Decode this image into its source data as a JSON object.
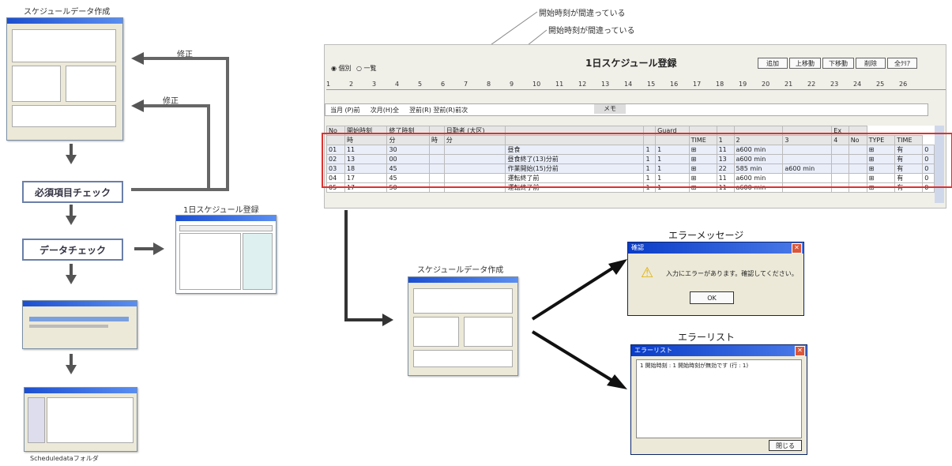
{
  "left_flow": {
    "top_caption": "スケジュールデータ作成",
    "fix_label_1": "修正",
    "fix_label_2": "修正",
    "box_required": "必須項目チェック",
    "box_data": "データチェック",
    "side_caption": "1日スケジュール登録",
    "bottom_caption": "Scheduledataフォルダ"
  },
  "annotations": {
    "note_1": "開始時刻が間違っている",
    "note_2": "開始時刻が間違っている"
  },
  "schedule_window": {
    "title": "1日スケジュール登録",
    "radio_1": "個別",
    "radio_2": "一覧",
    "buttons": [
      "追加",
      "上移動",
      "下移動",
      "削除",
      "全ｸﾘｱ"
    ],
    "day_tabs": [
      "1",
      "2",
      "3",
      "4",
      "5",
      "6",
      "7",
      "8",
      "9",
      "10",
      "11",
      "12",
      "13",
      "14",
      "15",
      "16",
      "17",
      "18",
      "19",
      "20",
      "21",
      "22",
      "23",
      "24",
      "25",
      "26"
    ],
    "filter_left": "当月 (P)前 　 次月(H)全 　 翌前(R) 翌前(R)前次",
    "filter_right": "メモ",
    "header_1": [
      "No",
      "開始時刻",
      "終了時刻",
      "",
      "日勤者 (大区)",
      "",
      "",
      "Guard",
      "",
      "",
      "",
      "",
      "Ex",
      ""
    ],
    "header_2": [
      "",
      "時",
      "分",
      "時",
      "分",
      "",
      "",
      "",
      "TIME",
      "1",
      "2",
      "3",
      "4",
      "No",
      "TYPE",
      "TIME"
    ],
    "rows": [
      [
        "01",
        "11",
        "30",
        "",
        "",
        "昼食",
        "1",
        "1",
        "⊞",
        "11",
        "a600 min",
        "",
        "",
        "",
        "⊞",
        "有",
        "0"
      ],
      [
        "02",
        "13",
        "00",
        "",
        "",
        "昼食終了(13)分前",
        "1",
        "1",
        "⊞",
        "13",
        "a600 min",
        "",
        "",
        "",
        "⊞",
        "有",
        "0"
      ],
      [
        "03",
        "18",
        "45",
        "",
        "",
        "作業開始(15)分前",
        "1",
        "1",
        "⊞",
        "22",
        "585 min",
        "a600 min",
        "",
        "",
        "⊞",
        "有",
        "0"
      ],
      [
        "04",
        "17",
        "45",
        "",
        "",
        "運転終了前",
        "1",
        "1",
        "⊞",
        "11",
        "a600 min",
        "",
        "",
        "",
        "⊞",
        "有",
        "0"
      ],
      [
        "05",
        "17",
        "50",
        "",
        "",
        "運転終了前",
        "1",
        "1",
        "⊞",
        "11",
        "a600 min",
        "",
        "",
        "",
        "⊞",
        "有",
        "0"
      ]
    ]
  },
  "right_flow": {
    "middle_caption": "スケジュールデータ作成",
    "error_msg_caption": "エラーメッセージ",
    "error_list_caption": "エラーリスト",
    "dialog_title": "確認",
    "dialog_text": "入力にエラーがあります。確認してください。",
    "dialog_ok": "OK",
    "list_title": "エラーリスト",
    "list_entry": "1 開始時刻 : 1 開始時刻が無効です (行 : 1)",
    "list_close": "閉じる"
  },
  "colors": {
    "flow_border": "#6a7fa8",
    "highlight_border": "#e03030",
    "titlebar": "#1c4fd0"
  }
}
